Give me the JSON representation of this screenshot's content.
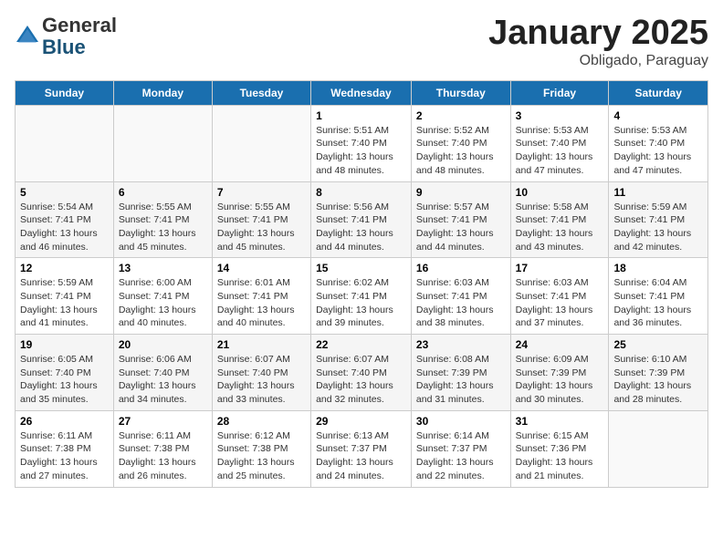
{
  "header": {
    "logo_general": "General",
    "logo_blue": "Blue",
    "calendar_title": "January 2025",
    "calendar_subtitle": "Obligado, Paraguay"
  },
  "days_of_week": [
    "Sunday",
    "Monday",
    "Tuesday",
    "Wednesday",
    "Thursday",
    "Friday",
    "Saturday"
  ],
  "weeks": [
    [
      {
        "num": "",
        "info": ""
      },
      {
        "num": "",
        "info": ""
      },
      {
        "num": "",
        "info": ""
      },
      {
        "num": "1",
        "info": "Sunrise: 5:51 AM\nSunset: 7:40 PM\nDaylight: 13 hours\nand 48 minutes."
      },
      {
        "num": "2",
        "info": "Sunrise: 5:52 AM\nSunset: 7:40 PM\nDaylight: 13 hours\nand 48 minutes."
      },
      {
        "num": "3",
        "info": "Sunrise: 5:53 AM\nSunset: 7:40 PM\nDaylight: 13 hours\nand 47 minutes."
      },
      {
        "num": "4",
        "info": "Sunrise: 5:53 AM\nSunset: 7:40 PM\nDaylight: 13 hours\nand 47 minutes."
      }
    ],
    [
      {
        "num": "5",
        "info": "Sunrise: 5:54 AM\nSunset: 7:41 PM\nDaylight: 13 hours\nand 46 minutes."
      },
      {
        "num": "6",
        "info": "Sunrise: 5:55 AM\nSunset: 7:41 PM\nDaylight: 13 hours\nand 45 minutes."
      },
      {
        "num": "7",
        "info": "Sunrise: 5:55 AM\nSunset: 7:41 PM\nDaylight: 13 hours\nand 45 minutes."
      },
      {
        "num": "8",
        "info": "Sunrise: 5:56 AM\nSunset: 7:41 PM\nDaylight: 13 hours\nand 44 minutes."
      },
      {
        "num": "9",
        "info": "Sunrise: 5:57 AM\nSunset: 7:41 PM\nDaylight: 13 hours\nand 44 minutes."
      },
      {
        "num": "10",
        "info": "Sunrise: 5:58 AM\nSunset: 7:41 PM\nDaylight: 13 hours\nand 43 minutes."
      },
      {
        "num": "11",
        "info": "Sunrise: 5:59 AM\nSunset: 7:41 PM\nDaylight: 13 hours\nand 42 minutes."
      }
    ],
    [
      {
        "num": "12",
        "info": "Sunrise: 5:59 AM\nSunset: 7:41 PM\nDaylight: 13 hours\nand 41 minutes."
      },
      {
        "num": "13",
        "info": "Sunrise: 6:00 AM\nSunset: 7:41 PM\nDaylight: 13 hours\nand 40 minutes."
      },
      {
        "num": "14",
        "info": "Sunrise: 6:01 AM\nSunset: 7:41 PM\nDaylight: 13 hours\nand 40 minutes."
      },
      {
        "num": "15",
        "info": "Sunrise: 6:02 AM\nSunset: 7:41 PM\nDaylight: 13 hours\nand 39 minutes."
      },
      {
        "num": "16",
        "info": "Sunrise: 6:03 AM\nSunset: 7:41 PM\nDaylight: 13 hours\nand 38 minutes."
      },
      {
        "num": "17",
        "info": "Sunrise: 6:03 AM\nSunset: 7:41 PM\nDaylight: 13 hours\nand 37 minutes."
      },
      {
        "num": "18",
        "info": "Sunrise: 6:04 AM\nSunset: 7:41 PM\nDaylight: 13 hours\nand 36 minutes."
      }
    ],
    [
      {
        "num": "19",
        "info": "Sunrise: 6:05 AM\nSunset: 7:40 PM\nDaylight: 13 hours\nand 35 minutes."
      },
      {
        "num": "20",
        "info": "Sunrise: 6:06 AM\nSunset: 7:40 PM\nDaylight: 13 hours\nand 34 minutes."
      },
      {
        "num": "21",
        "info": "Sunrise: 6:07 AM\nSunset: 7:40 PM\nDaylight: 13 hours\nand 33 minutes."
      },
      {
        "num": "22",
        "info": "Sunrise: 6:07 AM\nSunset: 7:40 PM\nDaylight: 13 hours\nand 32 minutes."
      },
      {
        "num": "23",
        "info": "Sunrise: 6:08 AM\nSunset: 7:39 PM\nDaylight: 13 hours\nand 31 minutes."
      },
      {
        "num": "24",
        "info": "Sunrise: 6:09 AM\nSunset: 7:39 PM\nDaylight: 13 hours\nand 30 minutes."
      },
      {
        "num": "25",
        "info": "Sunrise: 6:10 AM\nSunset: 7:39 PM\nDaylight: 13 hours\nand 28 minutes."
      }
    ],
    [
      {
        "num": "26",
        "info": "Sunrise: 6:11 AM\nSunset: 7:38 PM\nDaylight: 13 hours\nand 27 minutes."
      },
      {
        "num": "27",
        "info": "Sunrise: 6:11 AM\nSunset: 7:38 PM\nDaylight: 13 hours\nand 26 minutes."
      },
      {
        "num": "28",
        "info": "Sunrise: 6:12 AM\nSunset: 7:38 PM\nDaylight: 13 hours\nand 25 minutes."
      },
      {
        "num": "29",
        "info": "Sunrise: 6:13 AM\nSunset: 7:37 PM\nDaylight: 13 hours\nand 24 minutes."
      },
      {
        "num": "30",
        "info": "Sunrise: 6:14 AM\nSunset: 7:37 PM\nDaylight: 13 hours\nand 22 minutes."
      },
      {
        "num": "31",
        "info": "Sunrise: 6:15 AM\nSunset: 7:36 PM\nDaylight: 13 hours\nand 21 minutes."
      },
      {
        "num": "",
        "info": ""
      }
    ]
  ]
}
